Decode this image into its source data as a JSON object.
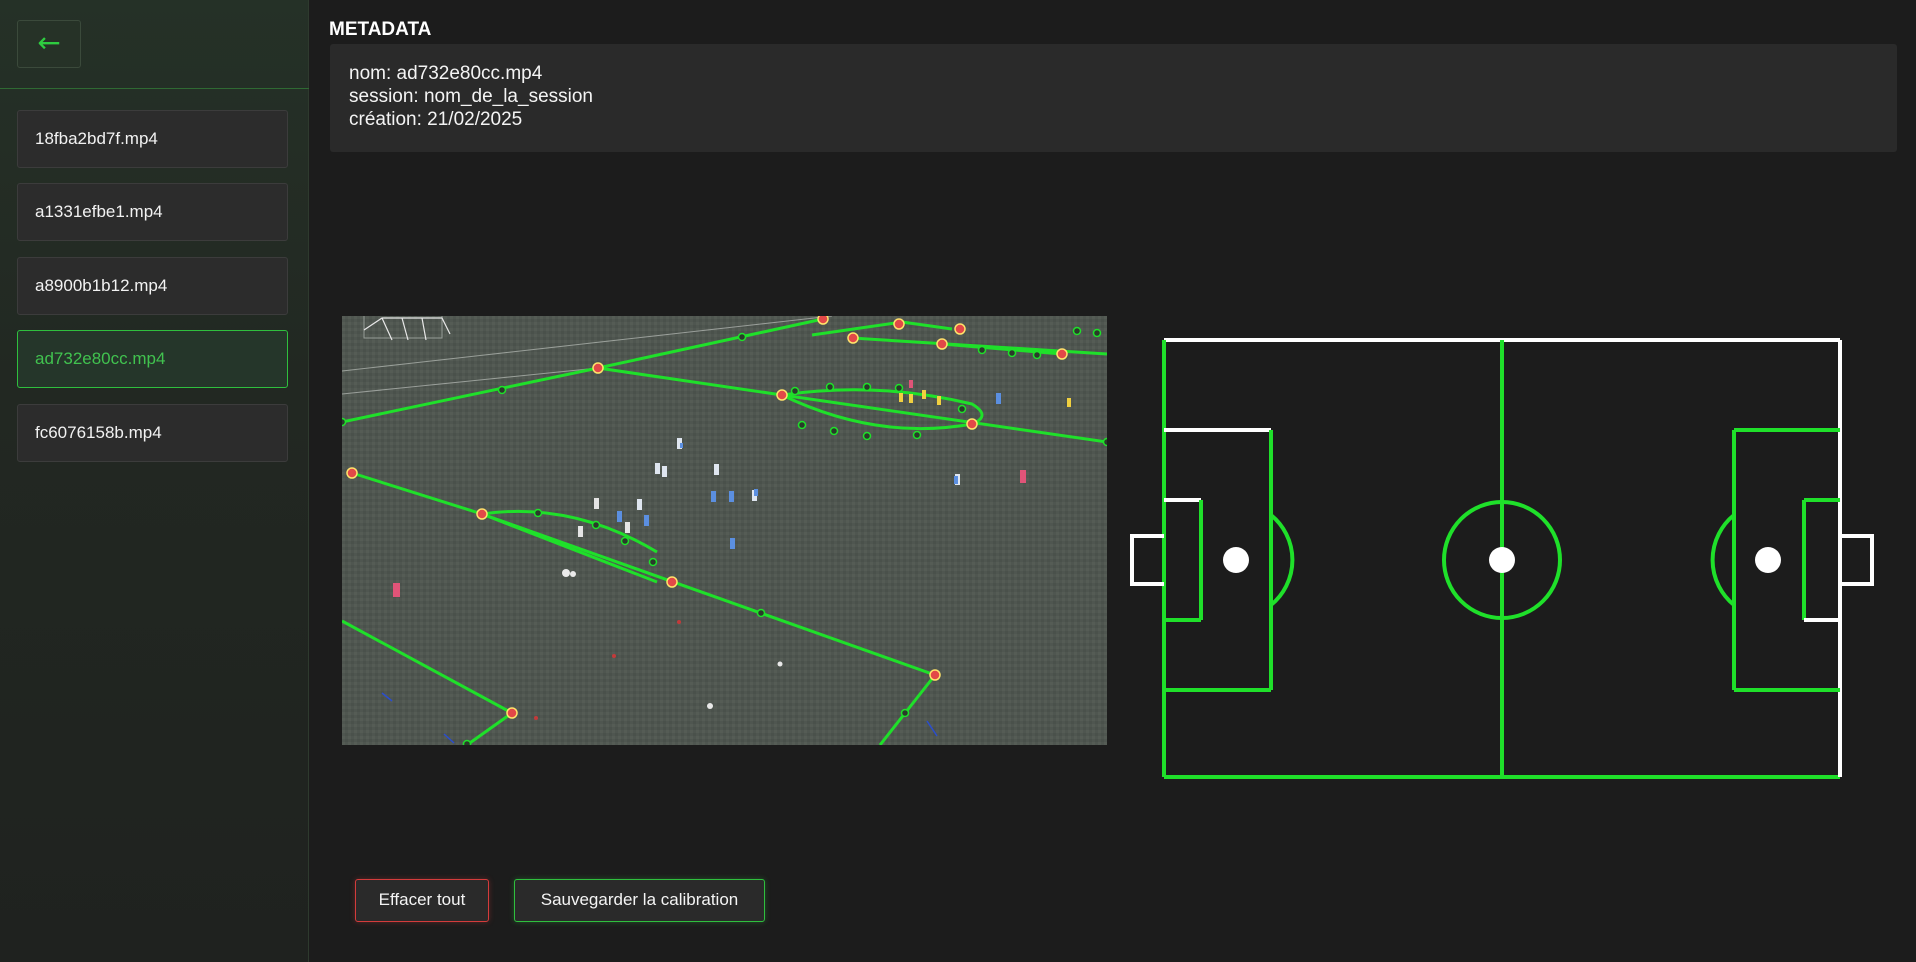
{
  "sidebar": {
    "back_icon": "←",
    "files": [
      {
        "name": "18fba2bd7f.mp4",
        "active": false
      },
      {
        "name": "a1331efbe1.mp4",
        "active": false
      },
      {
        "name": "a8900b1b12.mp4",
        "active": false
      },
      {
        "name": "ad732e80cc.mp4",
        "active": true
      },
      {
        "name": "fc6076158b.mp4",
        "active": false
      }
    ]
  },
  "metadata": {
    "title": "METADATA",
    "lines": [
      "nom: ad732e80cc.mp4",
      "session: nom_de_la_session",
      "création: 21/02/2025"
    ]
  },
  "actions": {
    "clear_label": "Effacer tout",
    "save_label": "Sauvegarder la calibration"
  },
  "colors": {
    "accent": "#2ecc40",
    "line_calibrated": "#1fe02a",
    "line_uncalibrated": "#ffffff",
    "danger": "#d43c3c"
  }
}
